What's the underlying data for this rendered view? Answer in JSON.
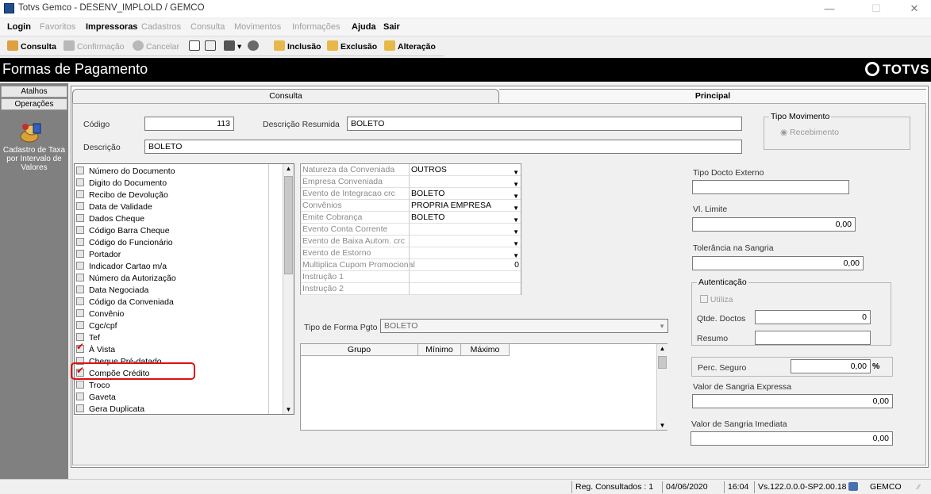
{
  "window": {
    "title": "Totvs Gemco - DESENV_IMPLOLD / GEMCO"
  },
  "menubar": {
    "items": [
      {
        "label": "Login",
        "enabled": true
      },
      {
        "label": "Favoritos",
        "enabled": false
      },
      {
        "label": "Impressoras",
        "enabled": true
      },
      {
        "label": "Cadastros",
        "enabled": false
      },
      {
        "label": "Consulta",
        "enabled": false
      },
      {
        "label": "Movimentos",
        "enabled": false
      },
      {
        "label": "Informações",
        "enabled": false
      },
      {
        "label": "Ajuda",
        "enabled": true
      },
      {
        "label": "Sair",
        "enabled": true
      }
    ]
  },
  "toolbar": {
    "consulta": "Consulta",
    "confirmacao": "Confirmação",
    "cancelar": "Cancelar",
    "inclusao": "Inclusão",
    "exclusao": "Exclusão",
    "alteracao": "Alteração"
  },
  "header": {
    "page_title": "Formas de Pagamento",
    "logo_text": "TOTVS"
  },
  "sidebar": {
    "tabs": [
      "Atalhos",
      "Operações"
    ],
    "shortcut_label": "Cadastro de Taxa por Intervalo de Valores"
  },
  "tabs": {
    "consulta": "Consulta",
    "principal": "Principal"
  },
  "form": {
    "codigo_label": "Código",
    "codigo_value": "113",
    "desc_resumida_label": "Descrição Resumida",
    "desc_resumida_value": "BOLETO",
    "descricao_label": "Descrição",
    "descricao_value": "BOLETO",
    "tipo_movimento_label": "Tipo Movimento",
    "recebimento_label": "Recebimento",
    "tipo_forma_pgto_label": "Tipo de Forma Pgto",
    "tipo_forma_pgto_value": "BOLETO"
  },
  "checklist": [
    {
      "label": "Número do Documento",
      "checked": false
    },
    {
      "label": "Digito do Documento",
      "checked": false
    },
    {
      "label": "Recibo de Devolução",
      "checked": false
    },
    {
      "label": "Data de Validade",
      "checked": false
    },
    {
      "label": "Dados Cheque",
      "checked": false
    },
    {
      "label": "Código Barra Cheque",
      "checked": false
    },
    {
      "label": "Código do Funcionário",
      "checked": false
    },
    {
      "label": "Portador",
      "checked": false
    },
    {
      "label": "Indicador Cartao m/a",
      "checked": false
    },
    {
      "label": "Número da Autorização",
      "checked": false
    },
    {
      "label": "Data Negociada",
      "checked": false
    },
    {
      "label": "Código da Conveniada",
      "checked": false
    },
    {
      "label": "Convênio",
      "checked": false
    },
    {
      "label": "Cgc/cpf",
      "checked": false
    },
    {
      "label": "Tef",
      "checked": false
    },
    {
      "label": "À Vista",
      "checked": true
    },
    {
      "label": "Cheque Pré-datado",
      "checked": false
    },
    {
      "label": "Compõe Crédito",
      "checked": true
    },
    {
      "label": "Troco",
      "checked": false
    },
    {
      "label": "Gaveta",
      "checked": false
    },
    {
      "label": "Gera Duplicata",
      "checked": false
    }
  ],
  "properties": [
    {
      "name": "Natureza da Conveniada",
      "value": "OUTROS",
      "dropdown": true
    },
    {
      "name": "Empresa Conveniada",
      "value": "",
      "dropdown": true
    },
    {
      "name": "Evento de Integracao crc",
      "value": "BOLETO",
      "dropdown": true
    },
    {
      "name": "Convênios",
      "value": "PROPRIA EMPRESA",
      "dropdown": true
    },
    {
      "name": "Emite Cobrança",
      "value": "BOLETO",
      "dropdown": true
    },
    {
      "name": "Evento Conta Corrente",
      "value": "",
      "dropdown": true
    },
    {
      "name": "Evento de Baixa Autom. crc",
      "value": "",
      "dropdown": true
    },
    {
      "name": "Evento de Estorno",
      "value": "",
      "dropdown": true
    },
    {
      "name": "Multiplica Cupom Promocional",
      "value": "0",
      "dropdown": false
    },
    {
      "name": "Instrução 1",
      "value": "",
      "dropdown": false
    },
    {
      "name": "Instrução 2",
      "value": "",
      "dropdown": false
    }
  ],
  "group_grid": {
    "headers": [
      "Grupo",
      "Mínimo",
      "Máximo"
    ]
  },
  "right": {
    "tipo_docto_externo_label": "Tipo Docto Externo",
    "tipo_docto_externo_value": "",
    "vl_limite_label": "Vl. Limite",
    "vl_limite_value": "0,00",
    "tolerancia_label": "Tolerância na Sangria",
    "tolerancia_value": "0,00",
    "autenticacao_label": "Autenticação",
    "utiliza_label": "Utiliza",
    "qtde_doctos_label": "Qtde. Doctos",
    "qtde_doctos_value": "0",
    "resumo_label": "Resumo",
    "resumo_value": "",
    "perc_seguro_label": "Perc. Seguro",
    "perc_seguro_value": "0,00",
    "perc_symbol": "%",
    "sangria_expressa_label": "Valor de Sangria Expressa",
    "sangria_expressa_value": "0,00",
    "sangria_imediata_label": "Valor de Sangria Imediata",
    "sangria_imediata_value": "0,00"
  },
  "statusbar": {
    "reg_consultados": "Reg. Consultados : 1",
    "date": "04/06/2020",
    "time": "16:04",
    "version": "Vs.122.0.0.0-SP2.00.18",
    "company": "GEMCO"
  },
  "colors": {
    "header_bg": "#000000",
    "sidebar_bg": "#808080",
    "highlight": "#dd1111",
    "check": "#cc0000"
  }
}
